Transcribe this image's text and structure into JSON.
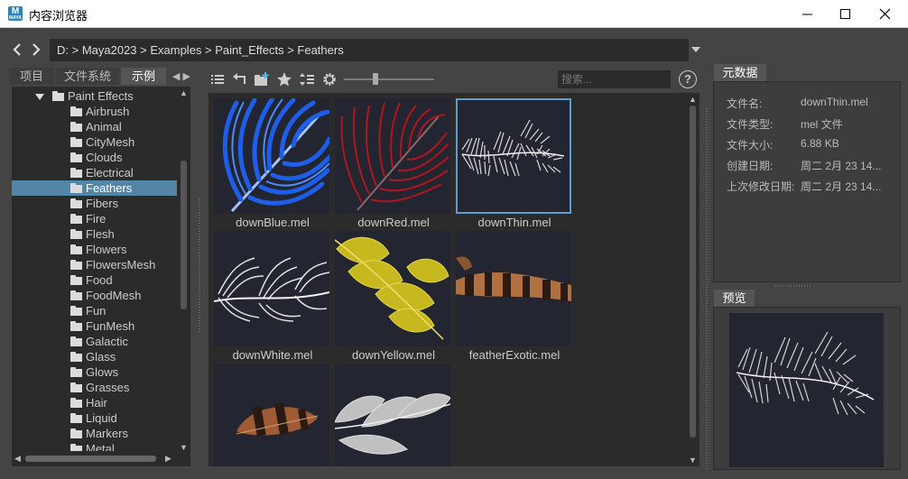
{
  "window": {
    "title": "内容浏览器",
    "app_icon_letter": "M",
    "app_icon_sub": "MAYA",
    "controls": [
      "minimize-icon",
      "maximize-icon",
      "close-icon"
    ]
  },
  "path": {
    "text": "D:  >  Maya2023  >  Examples  >  Paint_Effects  >  Feathers"
  },
  "left_tabs": {
    "project": "项目",
    "filesystem": "文件系统",
    "examples": "示例",
    "active": "示例"
  },
  "tree": {
    "parent": "Paint Effects",
    "items": [
      "Airbrush",
      "Animal",
      "CityMesh",
      "Clouds",
      "Electrical",
      "Feathers",
      "Fibers",
      "Fire",
      "Flesh",
      "Flowers",
      "FlowersMesh",
      "Food",
      "FoodMesh",
      "Fun",
      "FunMesh",
      "Galactic",
      "Glass",
      "Glows",
      "Grasses",
      "Hair",
      "Liquid",
      "Markers",
      "Metal"
    ],
    "selected": "Feathers"
  },
  "toolbar": {
    "icons": [
      "list-view-icon",
      "go-up-icon",
      "new-folder-icon",
      "favorite-star-icon",
      "sort-icon",
      "settings-gear-icon"
    ],
    "zoom_level": 0.35,
    "search_placeholder": "搜索...",
    "help_label": "?"
  },
  "grid": {
    "items": [
      {
        "label": "downBlue.mel",
        "color": "#2f6fe0"
      },
      {
        "label": "downRed.mel",
        "color": "#b01c22"
      },
      {
        "label": "downThin.mel",
        "color": "#d8d8d8"
      },
      {
        "label": "downWhite.mel",
        "color": "#e2e2e2"
      },
      {
        "label": "downYellow.mel",
        "color": "#cfc02a"
      },
      {
        "label": "featherExotic.mel",
        "color": "#a86a3c"
      },
      {
        "label": "",
        "color": "#a05a34"
      },
      {
        "label": "",
        "color": "#c8c8c8"
      }
    ],
    "selected": "downThin.mel"
  },
  "metadata": {
    "tab": "元数据",
    "rows": [
      {
        "key": "文件名:",
        "value": "downThin.mel"
      },
      {
        "key": "文件类型:",
        "value": "mel 文件"
      },
      {
        "key": "文件大小:",
        "value": "6.88 KB"
      },
      {
        "key": "创建日期:",
        "value": "周二 2月 23 14..."
      },
      {
        "key": "上次修改日期:",
        "value": "周二 2月 23 14..."
      }
    ]
  },
  "preview": {
    "tab": "预览"
  },
  "colors": {
    "selection": "#5285a6",
    "selected_border": "#5b9fd6",
    "panel_dark": "#2b2b2b",
    "background": "#444444"
  }
}
